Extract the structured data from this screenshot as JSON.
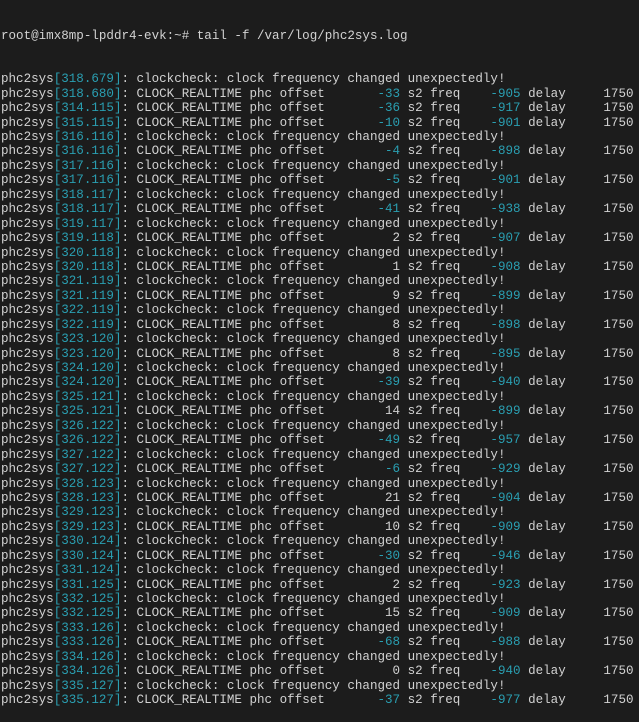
{
  "terminal": {
    "prompt": "root@imx8mp-lpddr4-evk:~# tail -f /var/log/phc2sys.log",
    "colors": {
      "background": "#1c1c1c",
      "text": "#d2d2d2",
      "accent": "#2a9fb2"
    },
    "process": "phc2sys",
    "clockcheck_message": "clockcheck: clock frequency changed unexpectedly!",
    "lines": [
      {
        "ts": "318.679",
        "type": "check"
      },
      {
        "ts": "318.680",
        "type": "offset",
        "offset": -33,
        "freq": -905,
        "delay": 1750
      },
      {
        "ts": "314.115",
        "type": "offset",
        "offset": -36,
        "freq": -917,
        "delay": 1750
      },
      {
        "ts": "315.115",
        "type": "offset",
        "offset": -10,
        "freq": -901,
        "delay": 1750
      },
      {
        "ts": "316.116",
        "type": "check"
      },
      {
        "ts": "316.116",
        "type": "offset",
        "offset": -4,
        "freq": -898,
        "delay": 1750
      },
      {
        "ts": "317.116",
        "type": "check"
      },
      {
        "ts": "317.116",
        "type": "offset",
        "offset": -5,
        "freq": -901,
        "delay": 1750
      },
      {
        "ts": "318.117",
        "type": "check"
      },
      {
        "ts": "318.117",
        "type": "offset",
        "offset": -41,
        "freq": -938,
        "delay": 1750
      },
      {
        "ts": "319.117",
        "type": "check"
      },
      {
        "ts": "319.118",
        "type": "offset",
        "offset": 2,
        "freq": -907,
        "delay": 1750
      },
      {
        "ts": "320.118",
        "type": "check"
      },
      {
        "ts": "320.118",
        "type": "offset",
        "offset": 1,
        "freq": -908,
        "delay": 1750
      },
      {
        "ts": "321.119",
        "type": "check"
      },
      {
        "ts": "321.119",
        "type": "offset",
        "offset": 9,
        "freq": -899,
        "delay": 1750
      },
      {
        "ts": "322.119",
        "type": "check"
      },
      {
        "ts": "322.119",
        "type": "offset",
        "offset": 8,
        "freq": -898,
        "delay": 1750
      },
      {
        "ts": "323.120",
        "type": "check"
      },
      {
        "ts": "323.120",
        "type": "offset",
        "offset": 8,
        "freq": -895,
        "delay": 1750
      },
      {
        "ts": "324.120",
        "type": "check"
      },
      {
        "ts": "324.120",
        "type": "offset",
        "offset": -39,
        "freq": -940,
        "delay": 1750
      },
      {
        "ts": "325.121",
        "type": "check"
      },
      {
        "ts": "325.121",
        "type": "offset",
        "offset": 14,
        "freq": -899,
        "delay": 1750
      },
      {
        "ts": "326.122",
        "type": "check"
      },
      {
        "ts": "326.122",
        "type": "offset",
        "offset": -49,
        "freq": -957,
        "delay": 1750
      },
      {
        "ts": "327.122",
        "type": "check"
      },
      {
        "ts": "327.122",
        "type": "offset",
        "offset": -6,
        "freq": -929,
        "delay": 1750
      },
      {
        "ts": "328.123",
        "type": "check"
      },
      {
        "ts": "328.123",
        "type": "offset",
        "offset": 21,
        "freq": -904,
        "delay": 1750
      },
      {
        "ts": "329.123",
        "type": "check"
      },
      {
        "ts": "329.123",
        "type": "offset",
        "offset": 10,
        "freq": -909,
        "delay": 1750
      },
      {
        "ts": "330.124",
        "type": "check"
      },
      {
        "ts": "330.124",
        "type": "offset",
        "offset": -30,
        "freq": -946,
        "delay": 1750
      },
      {
        "ts": "331.124",
        "type": "check"
      },
      {
        "ts": "331.125",
        "type": "offset",
        "offset": 2,
        "freq": -923,
        "delay": 1750
      },
      {
        "ts": "332.125",
        "type": "check"
      },
      {
        "ts": "332.125",
        "type": "offset",
        "offset": 15,
        "freq": -909,
        "delay": 1750
      },
      {
        "ts": "333.126",
        "type": "check"
      },
      {
        "ts": "333.126",
        "type": "offset",
        "offset": -68,
        "freq": -988,
        "delay": 1750
      },
      {
        "ts": "334.126",
        "type": "check"
      },
      {
        "ts": "334.126",
        "type": "offset",
        "offset": 0,
        "freq": -940,
        "delay": 1750
      },
      {
        "ts": "335.127",
        "type": "check"
      },
      {
        "ts": "335.127",
        "type": "offset",
        "offset": -37,
        "freq": -977,
        "delay": 1750
      }
    ]
  }
}
